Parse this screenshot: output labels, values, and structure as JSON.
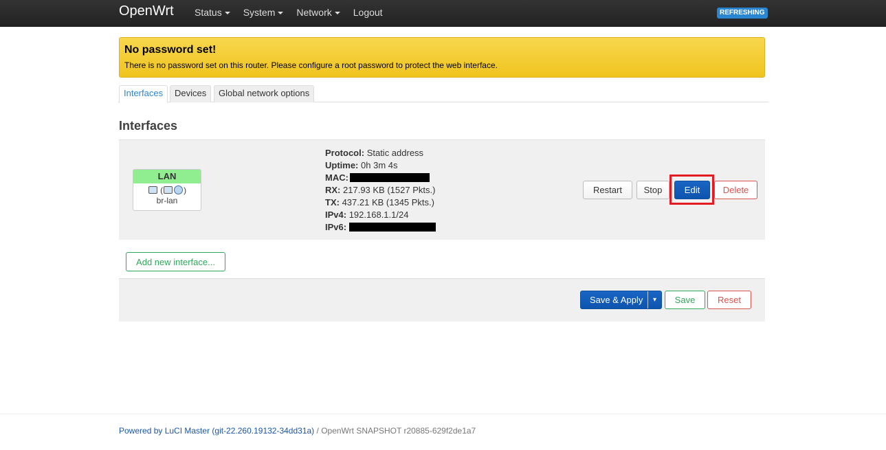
{
  "navbar": {
    "brand": "OpenWrt",
    "menu": [
      "Status",
      "System",
      "Network"
    ],
    "logout": "Logout",
    "status_badge": "REFRESHING"
  },
  "alert": {
    "title": "No password set!",
    "text": "There is no password set on this router. Please configure a root password to protect the web interface."
  },
  "tabs": [
    "Interfaces",
    "Devices",
    "Global network options"
  ],
  "section_title": "Interfaces",
  "interface": {
    "name": "LAN",
    "device": "br-lan",
    "protocol_label": "Protocol:",
    "protocol": "Static address",
    "uptime_label": "Uptime:",
    "uptime": "0h 3m 4s",
    "mac_label": "MAC:",
    "rx_label": "RX:",
    "rx": "217.93 KB (1527 Pkts.)",
    "tx_label": "TX:",
    "tx": "437.21 KB (1345 Pkts.)",
    "ipv4_label": "IPv4:",
    "ipv4": "192.168.1.1/24",
    "ipv6_label": "IPv6:"
  },
  "row_buttons": {
    "restart": "Restart",
    "stop": "Stop",
    "edit": "Edit",
    "delete": "Delete"
  },
  "add_interface": "Add new interface...",
  "actions": {
    "save_apply": "Save & Apply",
    "save": "Save",
    "reset": "Reset"
  },
  "footer": {
    "luci": "Powered by LuCI Master (git-22.260.19132-34dd31a)",
    "separator": " / ",
    "version": "OpenWrt SNAPSHOT r20885-629f2de1a7"
  },
  "colors": {
    "navbar": "#222222",
    "alert": "#f0c41f",
    "primary": "#0d54ae",
    "danger": "#d9534f",
    "success": "#2ea85a",
    "highlight": "#e31b23",
    "lan_badge": "#90ee90"
  }
}
